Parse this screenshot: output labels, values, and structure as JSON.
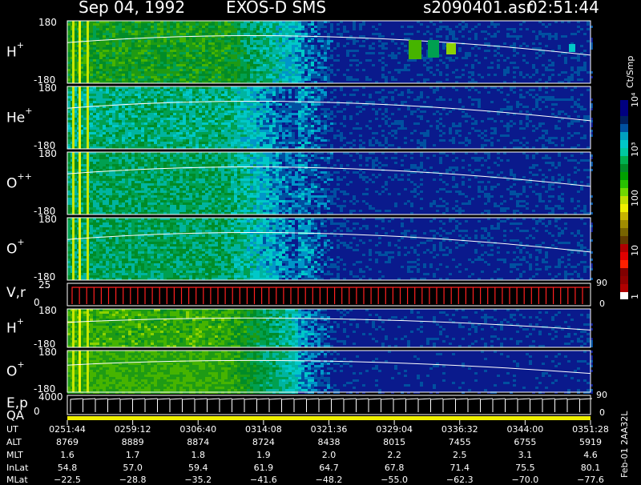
{
  "header": {
    "date": "Sep 04, 1992",
    "title": "EXOS-D SMS",
    "file": "s2090401.asr",
    "time": "02:51:44"
  },
  "panels": [
    {
      "label": "H",
      "sup": "+",
      "ymax": "180",
      "ymin": "-180"
    },
    {
      "label": "He",
      "sup": "+",
      "ymax": "180",
      "ymin": "-180"
    },
    {
      "label": "O",
      "sup": "++",
      "ymax": "180",
      "ymin": "-180"
    },
    {
      "label": "O",
      "sup": "+",
      "ymax": "180",
      "ymin": "-180"
    },
    {
      "label": "V,r",
      "sup": "",
      "ymax": "25",
      "ymin": "0",
      "rmax": "90",
      "rmin": "0"
    },
    {
      "label": "H",
      "sup": "+",
      "ymax": "180",
      "ymin": "-180"
    },
    {
      "label": "O",
      "sup": "+",
      "ymax": "180",
      "ymin": "-180"
    },
    {
      "label": "E,p",
      "sup": "",
      "ymax": "4000",
      "ymin": "0",
      "rmax": "90",
      "rmin": "0"
    }
  ],
  "qa_label": "QA",
  "colorbar": {
    "unit": "Ct/Smp",
    "ticks": [
      "1",
      "10",
      "100",
      "10³",
      "10⁴"
    ],
    "colors": [
      "#000080",
      "#000080",
      "#002060",
      "#0050a0",
      "#00a0c0",
      "#00c8c8",
      "#00c8a0",
      "#00b050",
      "#008c28",
      "#00a000",
      "#28c000",
      "#70d800",
      "#c0e000",
      "#f0f000",
      "#c8b400",
      "#a08c00",
      "#786400",
      "#603c00",
      "#b00000",
      "#e00000",
      "#ff2000",
      "#800000",
      "#900000",
      "#b00000",
      "#ffffff"
    ]
  },
  "footer": {
    "row_labels": [
      "UT",
      "ALT",
      "MLT",
      "InLat",
      "MLat"
    ],
    "columns": [
      {
        "UT": "0251:44",
        "ALT": "8769",
        "MLT": "1.6",
        "InLat": "54.8",
        "MLat": "−22.5"
      },
      {
        "UT": "0259:12",
        "ALT": "8889",
        "MLT": "1.7",
        "InLat": "57.0",
        "MLat": "−28.8"
      },
      {
        "UT": "0306:40",
        "ALT": "8874",
        "MLT": "1.8",
        "InLat": "59.4",
        "MLat": "−35.2"
      },
      {
        "UT": "0314:08",
        "ALT": "8724",
        "MLT": "1.9",
        "InLat": "61.9",
        "MLat": "−41.6"
      },
      {
        "UT": "0321:36",
        "ALT": "8438",
        "MLT": "2.0",
        "InLat": "64.7",
        "MLat": "−48.2"
      },
      {
        "UT": "0329:04",
        "ALT": "8015",
        "MLT": "2.2",
        "InLat": "67.8",
        "MLat": "−55.0"
      },
      {
        "UT": "0336:32",
        "ALT": "7455",
        "MLT": "2.5",
        "InLat": "71.4",
        "MLat": "−62.3"
      },
      {
        "UT": "0344:00",
        "ALT": "6755",
        "MLT": "3.1",
        "InLat": "75.5",
        "MLat": "−70.0"
      },
      {
        "UT": "0351:28",
        "ALT": "5919",
        "MLT": "4.6",
        "InLat": "80.1",
        "MLat": "−77.6"
      }
    ],
    "side_id": "Feb-01 2AA32L"
  },
  "chart_data": {
    "type": "heatmap",
    "title": "Sep 04, 1992    EXOS-D SMS",
    "x_ticks": [
      "0251:44",
      "0259:12",
      "0306:40",
      "0314:08",
      "0321:36",
      "0329:04",
      "0336:32",
      "0344:00",
      "0351:28"
    ],
    "xlim": [
      "0251:44",
      "0351:28"
    ],
    "colorscale": "log",
    "color_range": [
      1,
      10000
    ],
    "colorbar_label": "Ct/Smp",
    "panels": [
      "H+",
      "He+",
      "O++",
      "O+",
      "V,r",
      "H+",
      "O+",
      "E,p",
      "QA"
    ],
    "ylim_pitch": [
      -180,
      180
    ],
    "ylim_Vr": [
      0,
      25
    ],
    "ylim_Ep": [
      0,
      4000
    ],
    "activity_end_fraction": 0.44
  }
}
